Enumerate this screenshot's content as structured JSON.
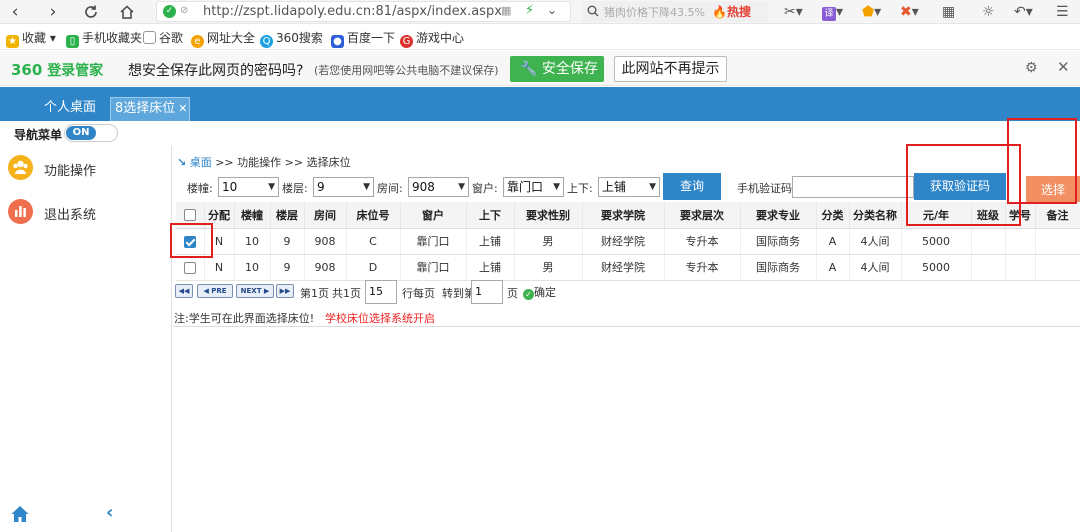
{
  "browser": {
    "back_icon": "‹",
    "forward_icon": "›",
    "url": "http://zspt.lidapoly.edu.cn:81/aspx/index.aspx",
    "search_placeholder": "猪肉价格下降43.5%",
    "search_hot": "热搜"
  },
  "bookmarks": [
    {
      "label": "收藏",
      "color": "#f0b400"
    },
    {
      "label": "手机收藏夹",
      "color": "#2bb24c"
    },
    {
      "label": "谷歌",
      "color": "#999999"
    },
    {
      "label": "网址大全",
      "color": "#f5a100"
    },
    {
      "label": "360搜索",
      "color": "#1ba1e2"
    },
    {
      "label": "百度一下",
      "color": "#2e5fd6"
    },
    {
      "label": "游戏中心",
      "color": "#d9302b"
    }
  ],
  "password_bar": {
    "logo": "360",
    "logo_suffix": "登录管家",
    "question": "想安全保存此网页的密码吗?",
    "note": "(若您使用网吧等公共电脑不建议保存)",
    "save_label": "安全保存",
    "never_label": "此网站不再提示"
  },
  "app": {
    "tabs": [
      {
        "label": "个人桌面"
      },
      {
        "label": "8选择床位"
      }
    ],
    "nav_label": "导航菜单",
    "nav_toggle": "ON",
    "sidebar": [
      {
        "label": "功能操作",
        "icon": "users-icon",
        "color": "#f5b21a"
      },
      {
        "label": "退出系统",
        "icon": "bar-chart-icon",
        "color": "#ee6e4e"
      }
    ]
  },
  "content": {
    "breadcrumb_home": "桌面",
    "breadcrumb_rest": ">> 功能操作 >> 选择床位",
    "filters": {
      "building_label": "楼幢:",
      "building_value": "10",
      "floor_label": "楼层:",
      "floor_value": "9",
      "room_label": "房间:",
      "room_value": "908",
      "window_label": "窗户:",
      "window_value": "靠门口",
      "bunk_label": "上下:",
      "bunk_value": "上铺",
      "query_label": "查询",
      "phone_label": "手机验证码:",
      "phone_value": "",
      "sms_label": "获取验证码",
      "choose_label": "选择"
    },
    "table": {
      "headers": [
        "",
        "分配",
        "楼幢",
        "楼层",
        "房间",
        "床位号",
        "窗户",
        "上下",
        "要求性别",
        "要求学院",
        "要求层次",
        "要求专业",
        "分类",
        "分类名称",
        "元/年",
        "班级",
        "学号",
        "备注"
      ],
      "rows": [
        {
          "checked": true,
          "cells": [
            "N",
            "10",
            "9",
            "908",
            "C",
            "靠门口",
            "上铺",
            "男",
            "财经学院",
            "专升本",
            "国际商务",
            "A",
            "4人间",
            "5000",
            "",
            "",
            ""
          ]
        },
        {
          "checked": false,
          "cells": [
            "N",
            "10",
            "9",
            "908",
            "D",
            "靠门口",
            "上铺",
            "男",
            "财经学院",
            "专升本",
            "国际商务",
            "A",
            "4人间",
            "5000",
            "",
            "",
            ""
          ]
        }
      ]
    },
    "pager": {
      "first": "◀◀",
      "prev": "◀ PRE",
      "next": "NEXT ▶",
      "last": "▶▶",
      "page_label": "第1页",
      "total_label": "共1页",
      "per_page_value": "15",
      "per_page_label": "行每页",
      "goto_label": "转到第",
      "goto_value": "1",
      "page_suffix": "页",
      "confirm_label": "确定"
    },
    "note_label": "注:学生可在此界面选择床位!",
    "note_status": "学校床位选择系统开启"
  },
  "colors": {
    "header_blue": "#2e85c8",
    "choose_orange": "#f39063",
    "highlight_red": "#e02020"
  }
}
